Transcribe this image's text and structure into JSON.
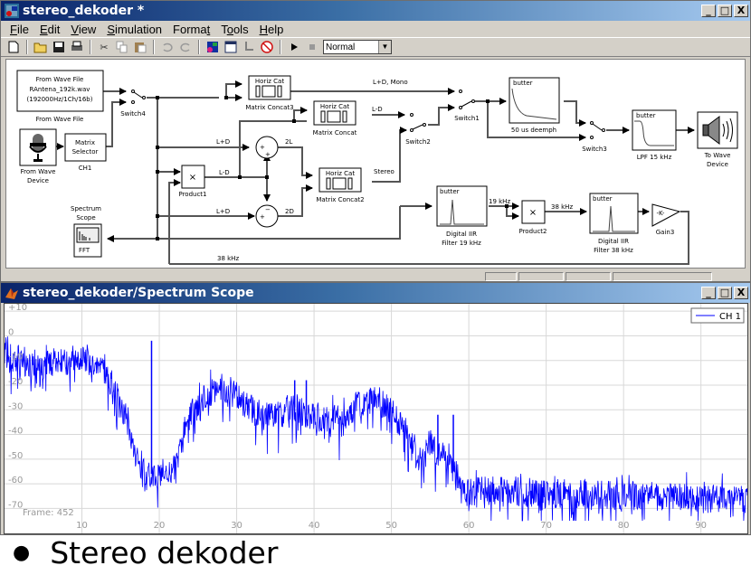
{
  "model_window": {
    "title": "stereo_dekoder *",
    "menu": [
      "File",
      "Edit",
      "View",
      "Simulation",
      "Format",
      "Tools",
      "Help"
    ],
    "menu_underline": [
      "F",
      "E",
      "V",
      "S",
      "t",
      "o",
      "H"
    ],
    "toolbar": {
      "icons": [
        "new-icon",
        "open-icon",
        "save-icon",
        "print-icon",
        "cut-icon",
        "copy-icon",
        "paste-icon",
        "undo-icon",
        "redo-icon",
        "library-browser-icon",
        "model-explorer-icon",
        "update-diagram-icon",
        "debug-icon",
        "start-icon",
        "stop-icon"
      ],
      "sim_mode": "Normal"
    },
    "window_buttons": {
      "minimize": "_",
      "maximize": "□",
      "close": "X"
    },
    "blocks": {
      "from_wave_file": {
        "lines": [
          "From Wave File",
          "RAntena_192k.wav",
          "(192000Hz/1Ch/16b)"
        ],
        "label": "From Wave File"
      },
      "from_wave_device": {
        "label1": "From Wave",
        "label2": "Device"
      },
      "matrix_selector": {
        "lines": [
          "Matrix",
          "Selector"
        ],
        "label": "CH1"
      },
      "switch4": "Switch4",
      "matrix_concat3": {
        "title": "Horiz Cat",
        "label": "Matrix Concat3"
      },
      "matrix_concat": {
        "title": "Horiz Cat",
        "label": "Matrix Concat"
      },
      "matrix_concat2": {
        "title": "Horiz Cat",
        "label": "Matrix Concat2"
      },
      "switch1": "Switch1",
      "switch2": "Switch2",
      "switch3": "Switch3",
      "deemph": {
        "title": "butter",
        "label": "50 us deemph"
      },
      "lpf": {
        "title": "butter",
        "label": "LPF 15 kHz"
      },
      "to_wave_device": {
        "label1": "To Wave",
        "label2": "Device"
      },
      "product1": {
        "symbol": "×",
        "label": "Product1"
      },
      "product2": {
        "symbol": "×",
        "label": "Product2"
      },
      "sum_top": {
        "out": "2L",
        "signs": [
          "+",
          "+"
        ]
      },
      "sum_bottom": {
        "out": "2D",
        "signs": [
          "+",
          "−"
        ]
      },
      "spectrum_scope": {
        "label1": "Spectrum",
        "label2": "Scope",
        "text": "FFT"
      },
      "filter19": {
        "title": "butter",
        "label1": "Digital IIR",
        "label2": "Filter 19 kHz"
      },
      "filter38": {
        "title": "butter",
        "label1": "Digital IIR",
        "label2": "Filter 38 kHz"
      },
      "gain3": {
        "symbol": "-K-",
        "label": "Gain3"
      }
    },
    "signal_labels": {
      "mono": "L+D, Mono",
      "lmd": "L-D",
      "lpd1": "L+D",
      "lmd2": "L-D",
      "lpd2": "L+D",
      "stereo": "Stereo",
      "khz19": "19 kHz",
      "khz38a": "38 kHz",
      "khz38b": "38 kHz"
    }
  },
  "scope_window": {
    "title": "stereo_dekoder/Spectrum Scope",
    "window_buttons": {
      "minimize": "_",
      "maximize": "□",
      "close": "X"
    },
    "frame_label": "Frame: 452",
    "legend": "CH 1",
    "trace_color": "#0000ff"
  },
  "chart_data": {
    "type": "line",
    "title": "",
    "xlabel": "",
    "ylabel": "",
    "xlim": [
      0,
      96
    ],
    "ylim": [
      -75,
      13
    ],
    "xticks": [
      10,
      20,
      30,
      40,
      50,
      60,
      70,
      80,
      90
    ],
    "yticks": [
      10,
      0,
      -10,
      -20,
      -30,
      -40,
      -50,
      -60,
      -70
    ],
    "ytick_labels": [
      "+10",
      "0",
      "-10",
      "-20",
      "-30",
      "-40",
      "-50",
      "-60",
      "-70"
    ],
    "grid": true,
    "legend_position": "top-right",
    "series": [
      {
        "name": "CH 1",
        "color": "#0000ff",
        "envelope_x": [
          0,
          2,
          5,
          8,
          10,
          12,
          14,
          16,
          17,
          18,
          19,
          20,
          21,
          22,
          23,
          24,
          26,
          28,
          30,
          32,
          34,
          36,
          37,
          38,
          39,
          40,
          42,
          44,
          46,
          48,
          50,
          52,
          53,
          54,
          55,
          56,
          57,
          58,
          59,
          60,
          65,
          70,
          75,
          80,
          85,
          90,
          96
        ],
        "envelope_y": [
          -8,
          -10,
          -12,
          -10,
          -9,
          -12,
          -20,
          -35,
          -48,
          -54,
          -56,
          -55,
          -56,
          -54,
          -40,
          -32,
          -24,
          -20,
          -24,
          -30,
          -33,
          -32,
          -28,
          -30,
          -32,
          -33,
          -33,
          -32,
          -28,
          -26,
          -30,
          -40,
          -48,
          -52,
          -42,
          -50,
          -45,
          -55,
          -60,
          -63,
          -63,
          -64,
          -64,
          -65,
          -65,
          -66,
          -66
        ],
        "spikes": [
          {
            "x": 19,
            "y": -2
          },
          {
            "x": 37.5,
            "y": -18
          },
          {
            "x": 39,
            "y": -18
          },
          {
            "x": 56,
            "y": -32
          },
          {
            "x": 58,
            "y": -32
          }
        ],
        "noise_spread_db": 12
      }
    ]
  },
  "slide": {
    "bullet_text": "Stereo dekoder"
  }
}
